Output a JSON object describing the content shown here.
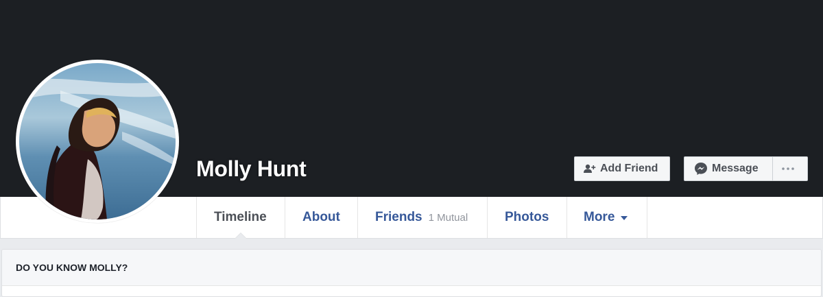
{
  "profile": {
    "name": "Molly Hunt",
    "avatar_icon": "profile-photo-woman-at-beach"
  },
  "actions": {
    "add_friend": "Add Friend",
    "message": "Message",
    "more_icon": "ellipsis-icon"
  },
  "tabs": [
    {
      "label": "Timeline",
      "active": true
    },
    {
      "label": "About"
    },
    {
      "label": "Friends",
      "sub": "1 Mutual"
    },
    {
      "label": "Photos"
    },
    {
      "label": "More"
    }
  ],
  "know_card": {
    "title": "DO YOU KNOW MOLLY?"
  },
  "colors": {
    "cover": "#1c1f23",
    "link": "#365899",
    "active_tab": "#4b4f56",
    "page_bg": "#e9ebee"
  }
}
